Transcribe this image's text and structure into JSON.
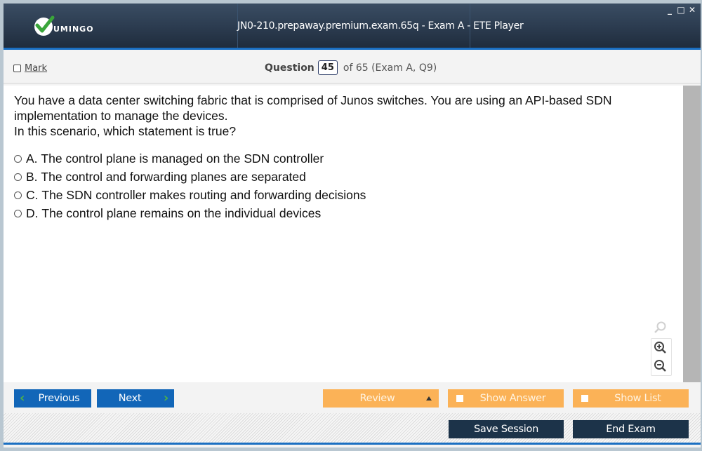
{
  "window": {
    "title": "JN0-210.prepaway.premium.exam.65q - Exam A - ETE Player",
    "logo_text": "UMINGO",
    "controls": {
      "minimize": "_",
      "maximize": "□",
      "close": "✕"
    }
  },
  "header": {
    "mark_label": "Mark",
    "question_label": "Question",
    "question_number": "45",
    "question_of": "of 65 (Exam A, Q9)"
  },
  "question": {
    "lines": [
      "You have a data center switching fabric that is comprised of Junos switches. You are using an API-based SDN",
      "implementation to manage the devices.",
      "In this scenario, which statement is true?"
    ],
    "options": [
      {
        "letter": "A.",
        "text": "The control plane is managed on the SDN controller"
      },
      {
        "letter": "B.",
        "text": "The control and forwarding planes are separated"
      },
      {
        "letter": "C.",
        "text": "The SDN controller makes routing and forwarding decisions"
      },
      {
        "letter": "D.",
        "text": "The control plane remains on the individual devices"
      }
    ]
  },
  "zoom_tools": [
    "search-icon",
    "zoom-in-icon",
    "zoom-out-icon"
  ],
  "nav": {
    "previous": "Previous",
    "next": "Next",
    "review": "Review",
    "show_answer": "Show Answer",
    "show_list": "Show List"
  },
  "footer": {
    "save_session": "Save Session",
    "end_exam": "End Exam"
  },
  "colors": {
    "nav_blue": "#1266b8",
    "accent_orange": "#fbb257",
    "footer_dark": "#1c3349",
    "titlebar": "#2b3b4f"
  }
}
